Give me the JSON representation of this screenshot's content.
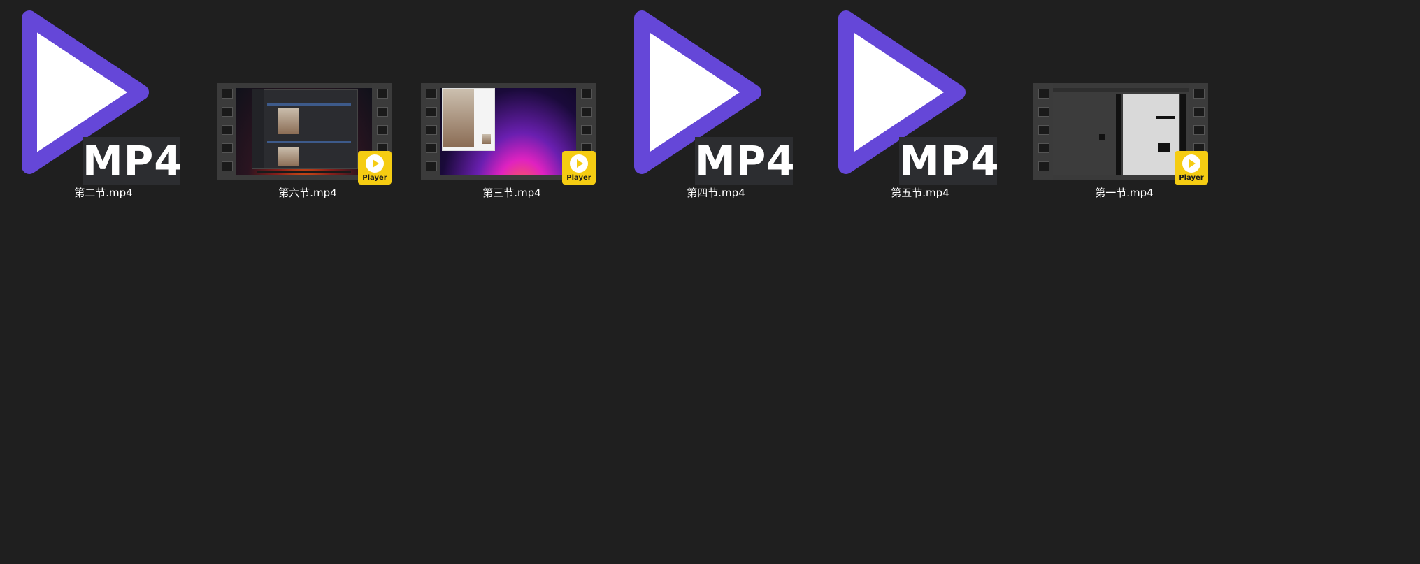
{
  "files": [
    {
      "name": "第二节.mp4",
      "thumb": "mp4-icon",
      "badge": "MP4"
    },
    {
      "name": "第六节.mp4",
      "thumb": "video-frame",
      "badge": "Player"
    },
    {
      "name": "第三节.mp4",
      "thumb": "video-frame",
      "badge": "Player"
    },
    {
      "name": "第四节.mp4",
      "thumb": "mp4-icon",
      "badge": "MP4"
    },
    {
      "name": "第五节.mp4",
      "thumb": "mp4-icon",
      "badge": "MP4"
    },
    {
      "name": "第一节.mp4",
      "thumb": "video-frame",
      "badge": "Player"
    }
  ],
  "colors": {
    "background": "#1f1f1f",
    "mp4_icon_purple": "#6547d8",
    "mp4_badge_bg": "#2c2d30",
    "player_badge": "#f5cc12"
  }
}
